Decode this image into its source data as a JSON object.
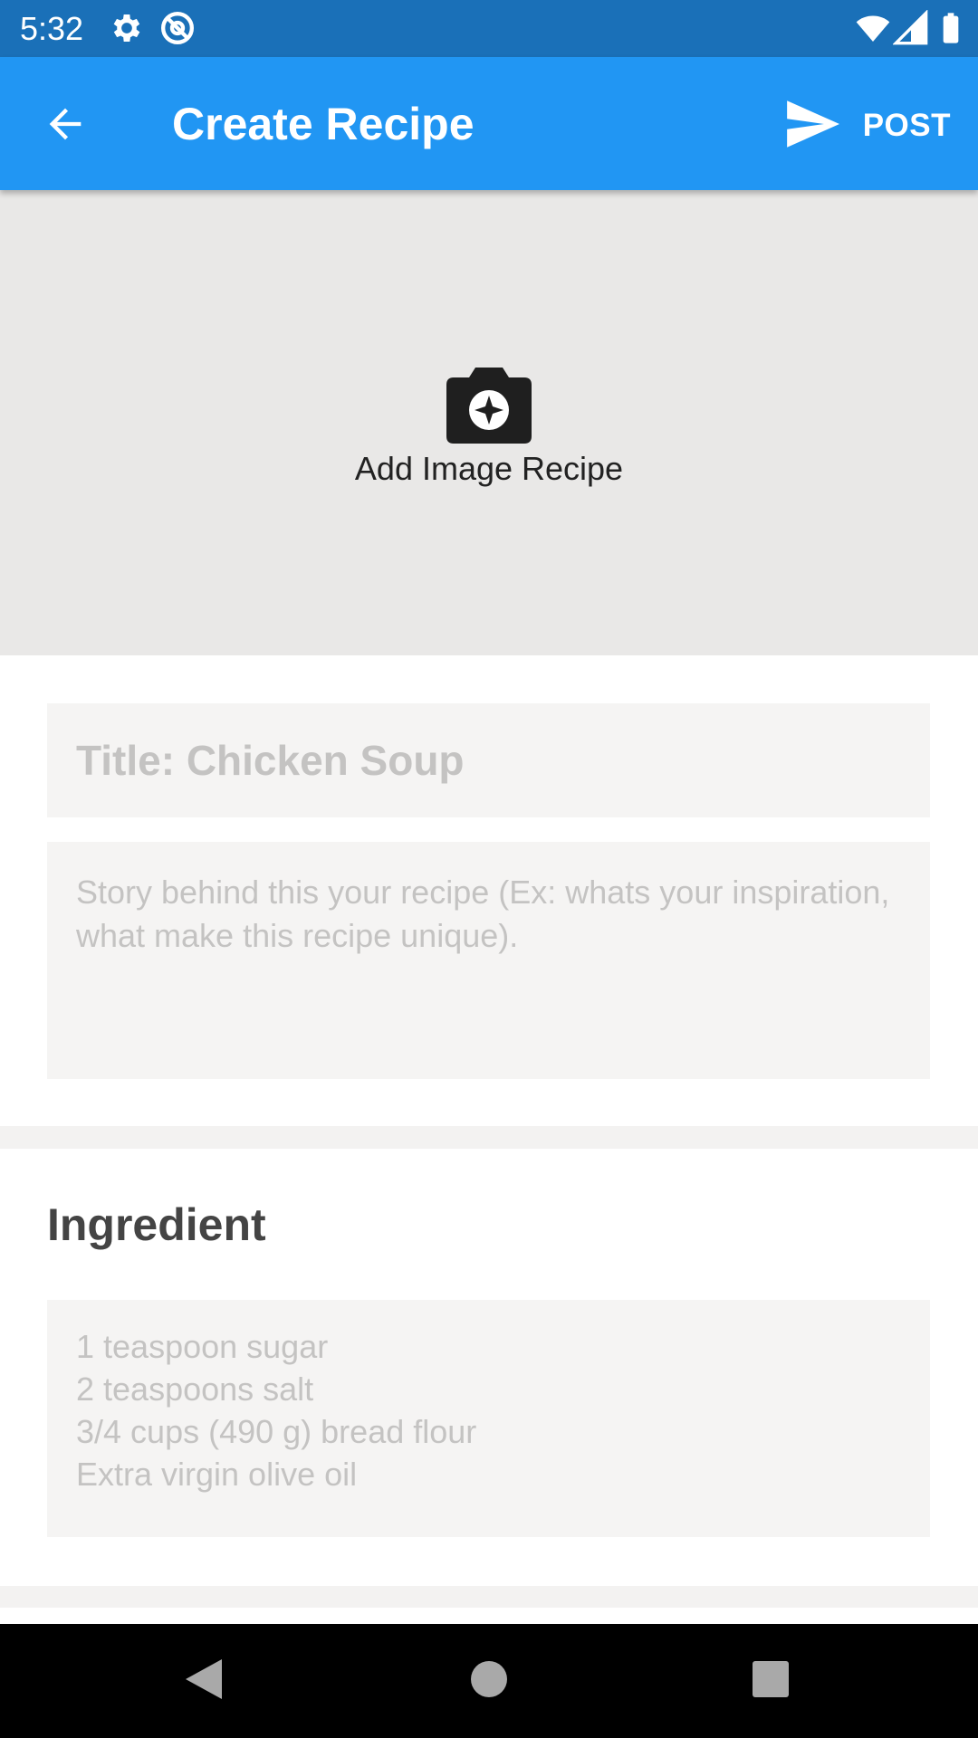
{
  "status_bar": {
    "time": "5:32",
    "icons": [
      "gear-icon",
      "at-sign-icon",
      "wifi-icon",
      "signal-icon",
      "battery-icon"
    ]
  },
  "app_bar": {
    "title": "Create Recipe",
    "post_label": "POST",
    "color": "#2196f3"
  },
  "image_picker": {
    "label": "Add Image Recipe"
  },
  "form": {
    "title_placeholder": "Title: Chicken Soup",
    "title_value": "",
    "story_placeholder": "Story behind this your recipe (Ex: whats your inspiration, what make this recipe unique).",
    "story_value": ""
  },
  "ingredients": {
    "heading": "Ingredient",
    "placeholder": "1 teaspoon sugar\n2 teaspoons salt\n3/4 cups (490 g) bread flour\nExtra virgin olive oil",
    "value": ""
  },
  "nav_bar": {
    "buttons": [
      "back-triangle-icon",
      "home-circle-icon",
      "recents-square-icon"
    ]
  }
}
